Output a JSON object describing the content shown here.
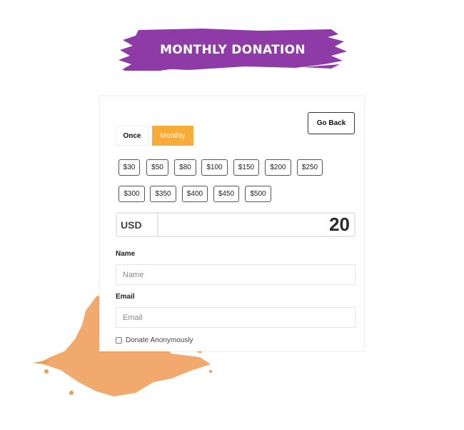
{
  "banner": {
    "title": "MONTHLY DONATION",
    "color": "#8e3ba8"
  },
  "frequency": {
    "once_label": "Once",
    "monthly_label": "Monthly",
    "selected": "Monthly",
    "accent": "#f8ab36"
  },
  "go_back_label": "Go Back",
  "amounts_row1": [
    "$30",
    "$50",
    "$80",
    "$100",
    "$150",
    "$200",
    "$250"
  ],
  "amounts_row2": [
    "$300",
    "$350",
    "$400",
    "$450",
    "$500"
  ],
  "currency": {
    "code": "USD",
    "amount": "20"
  },
  "name_field": {
    "label": "Name",
    "placeholder": "Name"
  },
  "email_field": {
    "label": "Email",
    "placeholder": "Email"
  },
  "anonymous": {
    "label": "Donate Anonymously",
    "checked": false
  },
  "splash_color": "#ef9a55"
}
